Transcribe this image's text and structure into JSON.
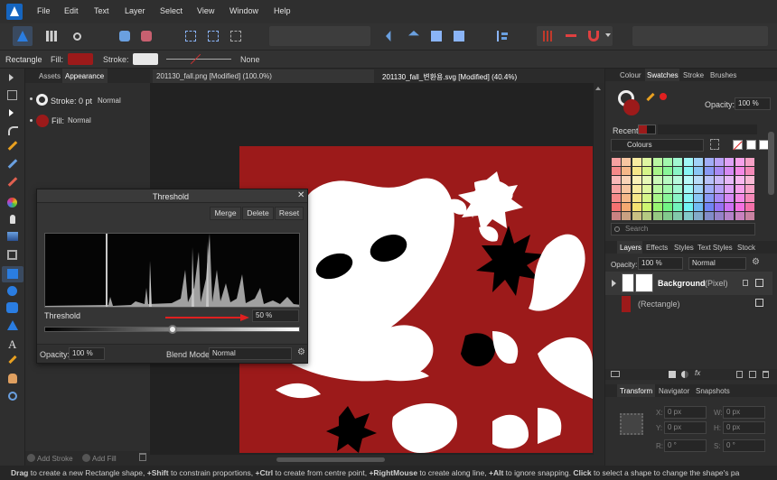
{
  "menu": [
    "File",
    "Edit",
    "Text",
    "Layer",
    "Select",
    "View",
    "Window",
    "Help"
  ],
  "context": {
    "tool": "Rectangle",
    "fill_label": "Fill:",
    "stroke_label": "Stroke:",
    "stroke_style": "None",
    "fill_color": "#9c1a1a",
    "stroke_color": "#e8e8e8"
  },
  "left_panel": {
    "tabs": [
      "Assets",
      "Appearance"
    ],
    "stroke_label": "Stroke: 0 pt",
    "stroke_mode": "Normal",
    "fill_label": "Fill:",
    "fill_mode": "Normal",
    "footer_add_stroke": "Add Stroke",
    "footer_add_fill": "Add Fill"
  },
  "doc_tabs": [
    {
      "title": "201130_fall.png [Modified] (100.0%)",
      "active": false
    },
    {
      "title": "201130_fall_변환용.svg [Modified] (40.4%)",
      "active": true
    }
  ],
  "threshold": {
    "title": "Threshold",
    "buttons": [
      "Merge",
      "Delete",
      "Reset"
    ],
    "label": "Threshold",
    "value": "50 %",
    "slider_fraction": 0.5,
    "opacity_label": "Opacity:",
    "opacity": "100 %",
    "blend_label": "Blend Mode:",
    "blend": "Normal"
  },
  "right_panel": {
    "top_tabs": [
      "Colour",
      "Swatches",
      "Stroke",
      "Brushes"
    ],
    "opacity_label": "Opacity:",
    "opacity": "100 %",
    "recent_label": "Recent:",
    "palette": "Colours",
    "search_placeholder": "Search",
    "layer_tabs": [
      "Layers",
      "Effects",
      "Styles",
      "Text Styles",
      "Stock"
    ],
    "layer_opacity_label": "Opacity:",
    "layer_opacity": "100 %",
    "layer_blend": "Normal",
    "layers": [
      {
        "name": "Background",
        "type": "(Pixel)"
      },
      {
        "name": "(Rectangle)",
        "type": ""
      }
    ],
    "transform_tabs": [
      "Transform",
      "Navigator",
      "Snapshots"
    ],
    "transform": {
      "x_label": "X:",
      "x": "0 px",
      "w_label": "W:",
      "w": "0 px",
      "y_label": "Y:",
      "y": "0 px",
      "h_label": "H:",
      "h": "0 px",
      "r_label": "R:",
      "r": "0 °",
      "s_label": "S:",
      "s": "0 °"
    }
  },
  "status": {
    "parts": [
      {
        "b": "Drag",
        "t": " to create a new Rectangle shape, "
      },
      {
        "b": "+Shift",
        "t": " to constrain proportions, "
      },
      {
        "b": "+Ctrl",
        "t": " to create from centre point, "
      },
      {
        "b": "+RightMouse",
        "t": " to create along line, "
      },
      {
        "b": "+Alt",
        "t": " to ignore snapping. "
      },
      {
        "b": "Click",
        "t": " to select a shape to change the shape's pa"
      }
    ]
  },
  "colors": {
    "accent": "#1565c0",
    "fill": "#9c1a1a",
    "panel": "#2e2e2e",
    "slider_arrow": "#e02020"
  }
}
